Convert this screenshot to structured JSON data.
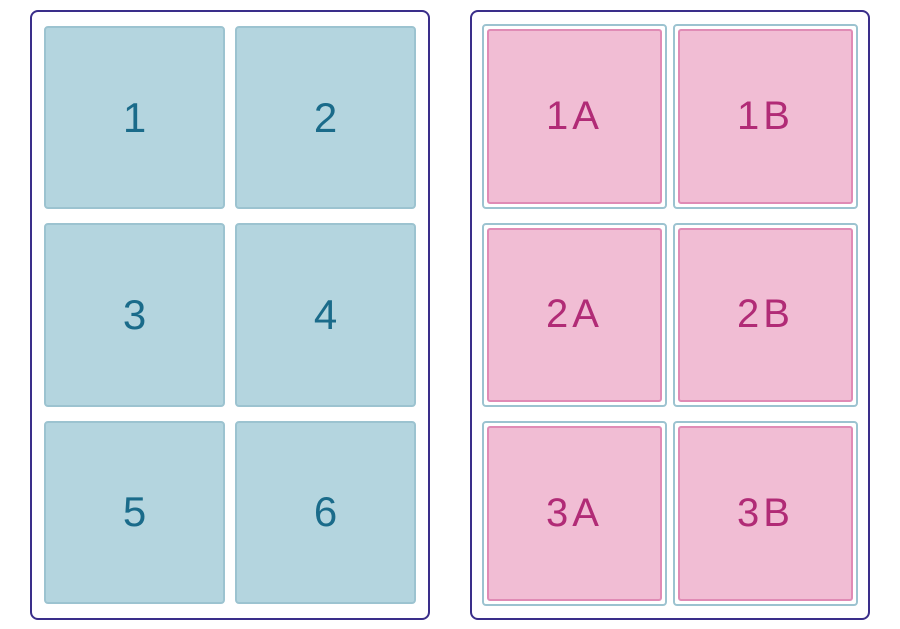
{
  "left_grid": {
    "cells": [
      "1",
      "2",
      "3",
      "4",
      "5",
      "6"
    ]
  },
  "right_grid": {
    "cells": [
      "1A",
      "1B",
      "2A",
      "2B",
      "3A",
      "3B"
    ]
  },
  "colors": {
    "panel_border": "#3a2e8a",
    "blue_fill": "#b4d5df",
    "blue_border": "#9cc3d0",
    "blue_text": "#1a6b8a",
    "pink_fill": "#f1bdd4",
    "pink_border": "#e08bb5",
    "pink_text": "#b12b76"
  }
}
